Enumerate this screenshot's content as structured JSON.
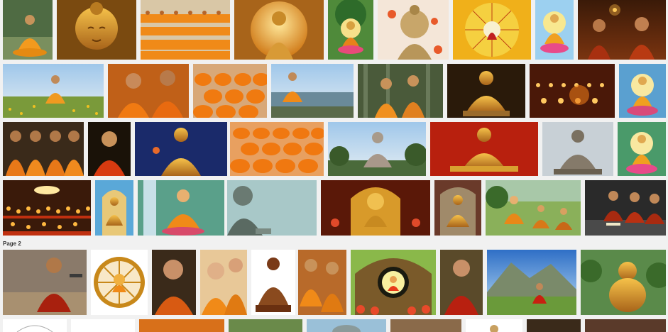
{
  "results": {
    "page_label": "Page 2",
    "images": [
      {
        "id": "r1-1",
        "subject": "meditating-monk"
      },
      {
        "id": "r1-2",
        "subject": "golden-buddha-face"
      },
      {
        "id": "r1-3",
        "subject": "monks-rows"
      },
      {
        "id": "r1-4",
        "subject": "many-armed-buddha"
      },
      {
        "id": "r1-5",
        "subject": "buddha-tree-painting"
      },
      {
        "id": "r1-6",
        "subject": "buddha-statue-petals"
      },
      {
        "id": "r1-7",
        "subject": "eightfold-path-diagram"
      },
      {
        "id": "r1-8",
        "subject": "buddha-lotus-blue"
      },
      {
        "id": "r1-9",
        "subject": "monks-candles"
      },
      {
        "id": "r2-1",
        "subject": "monk-meadow"
      },
      {
        "id": "r2-2",
        "subject": "praying-monks"
      },
      {
        "id": "r2-3",
        "subject": "monks-crowd"
      },
      {
        "id": "r2-4",
        "subject": "monk-cliff"
      },
      {
        "id": "r2-5",
        "subject": "monk-children-forest"
      },
      {
        "id": "r2-6",
        "subject": "golden-buddha-statue"
      },
      {
        "id": "r2-7",
        "subject": "candle-rows"
      },
      {
        "id": "r2-8",
        "subject": "buddha-painting"
      },
      {
        "id": "r3-1",
        "subject": "monks-praying-row"
      },
      {
        "id": "r3-2",
        "subject": "young-monk"
      },
      {
        "id": "r3-3",
        "subject": "buddha-blue-bg"
      },
      {
        "id": "r3-4",
        "subject": "monks-assembly"
      },
      {
        "id": "r3-5",
        "subject": "stone-buddha-sky"
      },
      {
        "id": "r3-6",
        "subject": "golden-buddha-red"
      },
      {
        "id": "r3-7",
        "subject": "stone-buddha-grey"
      },
      {
        "id": "r3-8",
        "subject": "buddha-lotus-painting"
      },
      {
        "id": "r4-1",
        "subject": "candle-ceremony"
      },
      {
        "id": "r4-2",
        "subject": "buddha-niche"
      },
      {
        "id": "r4-3",
        "subject": "buddha-waterfall-painting"
      },
      {
        "id": "r4-4",
        "subject": "giant-buddha-mist"
      },
      {
        "id": "r4-5",
        "subject": "temple-shrine"
      },
      {
        "id": "r4-6",
        "subject": "golden-buddha-shrine"
      },
      {
        "id": "r4-7",
        "subject": "buddha-disciples-painting"
      },
      {
        "id": "r4-8",
        "subject": "monks-reading"
      },
      {
        "id": "r5-1",
        "subject": "boy-monk-gun"
      },
      {
        "id": "r5-2",
        "subject": "dharma-wheel-buddha"
      },
      {
        "id": "r5-3",
        "subject": "old-monk"
      },
      {
        "id": "r5-4",
        "subject": "child-monks-smiling"
      },
      {
        "id": "r5-5",
        "subject": "bronze-buddha-white"
      },
      {
        "id": "r5-6",
        "subject": "monk-children-group"
      },
      {
        "id": "r5-7",
        "subject": "cartoon-buddha-cave"
      },
      {
        "id": "r5-8",
        "subject": "boy-monk-red"
      },
      {
        "id": "r5-9",
        "subject": "monk-mountain"
      },
      {
        "id": "r5-10",
        "subject": "laughing-buddha"
      }
    ]
  }
}
